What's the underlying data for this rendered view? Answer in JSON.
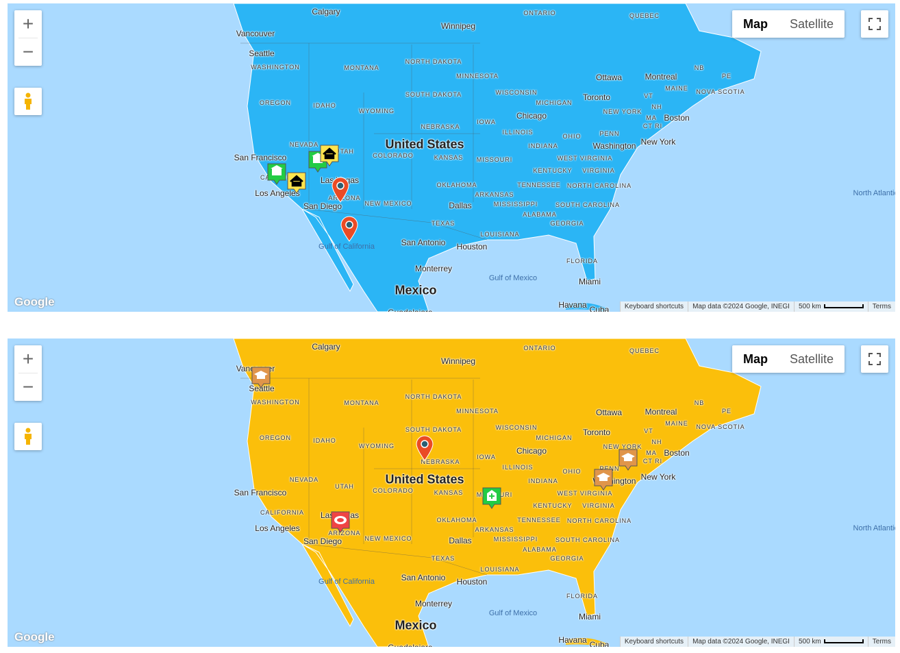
{
  "maps": [
    {
      "land_color": "#2bb5f5",
      "markers": [
        "building-marker",
        "building-marker",
        "house-marker",
        "house-marker",
        "pin-marker",
        "pin-marker"
      ]
    },
    {
      "land_color": "#fbbf0b",
      "markers": [
        "school-marker",
        "school-marker",
        "school-marker",
        "pin-marker",
        "hospital-marker",
        "stadium-marker"
      ]
    }
  ],
  "controls": {
    "zoom_in": "+",
    "zoom_out": "−",
    "map_type": "Map",
    "satellite": "Satellite"
  },
  "logo": "Google",
  "attribution": {
    "keyboard": "Keyboard shortcuts",
    "map_data": "Map data ©2024 Google, INEGI",
    "scale": "500 km",
    "terms": "Terms"
  },
  "labels": [
    "Calgary",
    "Vancouver",
    "Seattle",
    "WASHINGTON",
    "OREGON",
    "IDAHO",
    "MONTANA",
    "WYOMING",
    "NEVADA",
    "UTAH",
    "COLORADO",
    "NORTH DAKOTA",
    "SOUTH DAKOTA",
    "NEBRASKA",
    "KANSAS",
    "MINNESOTA",
    "IOWA",
    "MISSOURI",
    "OKLAHOMA",
    "TEXAS",
    "NEW MEXICO",
    "ARIZONA",
    "CALIFORNIA",
    "ARKANSAS",
    "LOUISIANA",
    "MISSISSIPPI",
    "ALABAMA",
    "GEORGIA",
    "FLORIDA",
    "TENNESSEE",
    "KENTUCKY",
    "ILLINOIS",
    "INDIANA",
    "OHIO",
    "MICHIGAN",
    "WISCONSIN",
    "PENN",
    "WEST VIRGINIA",
    "VIRGINIA",
    "NORTH CAROLINA",
    "SOUTH CAROLINA",
    "NEW YORK",
    "VT",
    "NH",
    "MA",
    "CT RI",
    "MAINE",
    "NB",
    "PE",
    "NOVA SCOTIA",
    "ONTARIO",
    "QUEBEC",
    "Winnipeg",
    "Ottawa",
    "Montreal",
    "Toronto",
    "Boston",
    "New York",
    "Washington",
    "Chicago",
    "San Francisco",
    "Los Angeles",
    "Las Vegas",
    "San Diego",
    "Dallas",
    "San Antonio",
    "Houston",
    "Monterrey",
    "Miami",
    "Havana",
    "Cuba",
    "Guadalajara",
    "United States",
    "Mexico",
    "Gulf of Mexico",
    "Gulf of California",
    "North Atlantic Ocean"
  ]
}
